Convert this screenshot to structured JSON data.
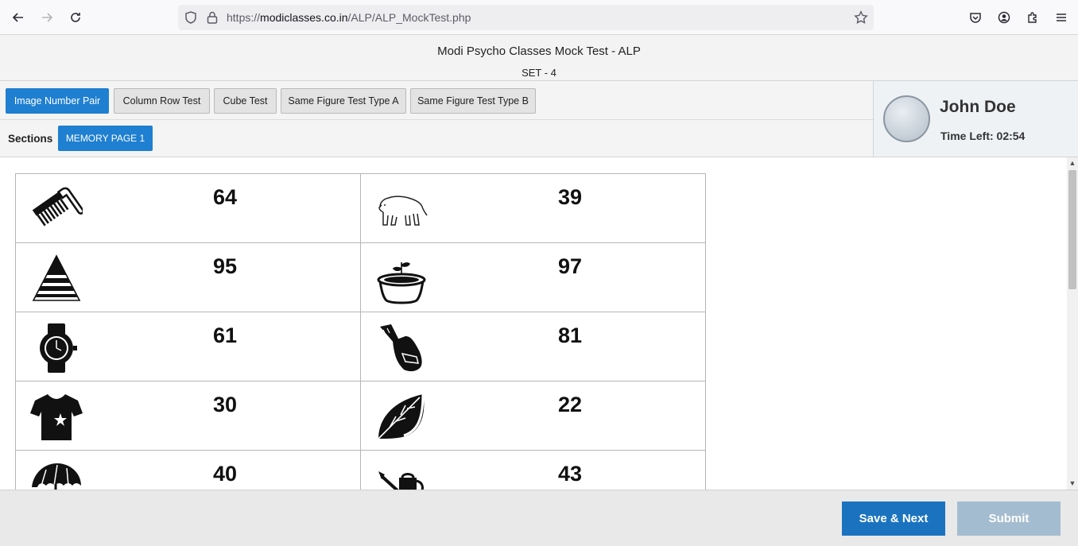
{
  "browser": {
    "url_prefix": "https://",
    "url_host": "modiclasses.co.in",
    "url_path": "/ALP/ALP_MockTest.php"
  },
  "header": {
    "title": "Modi Psycho Classes Mock Test - ALP",
    "set": "SET - 4"
  },
  "tabs": [
    {
      "label": "Image Number Pair",
      "active": true
    },
    {
      "label": "Column Row Test",
      "active": false
    },
    {
      "label": "Cube Test",
      "active": false
    },
    {
      "label": "Same Figure Test Type A",
      "active": false
    },
    {
      "label": "Same Figure Test Type B",
      "active": false
    }
  ],
  "sections": {
    "label": "Sections",
    "button": "MEMORY PAGE 1"
  },
  "profile": {
    "name": "John Doe",
    "time_left": "Time Left: 02:54"
  },
  "pairs": [
    {
      "left_icon": "comb-icon",
      "left_number": "64",
      "right_icon": "bear-icon",
      "right_number": "39"
    },
    {
      "left_icon": "pyramid-icon",
      "left_number": "95",
      "right_icon": "plant-pot-icon",
      "right_number": "97"
    },
    {
      "left_icon": "wristwatch-icon",
      "left_number": "61",
      "right_icon": "car-key-icon",
      "right_number": "81"
    },
    {
      "left_icon": "tshirt-icon",
      "left_number": "30",
      "right_icon": "leaf-icon",
      "right_number": "22"
    },
    {
      "left_icon": "umbrella-icon",
      "left_number": "40",
      "right_icon": "watering-can-icon",
      "right_number": "43"
    }
  ],
  "footer": {
    "save_next": "Save & Next",
    "submit": "Submit"
  }
}
